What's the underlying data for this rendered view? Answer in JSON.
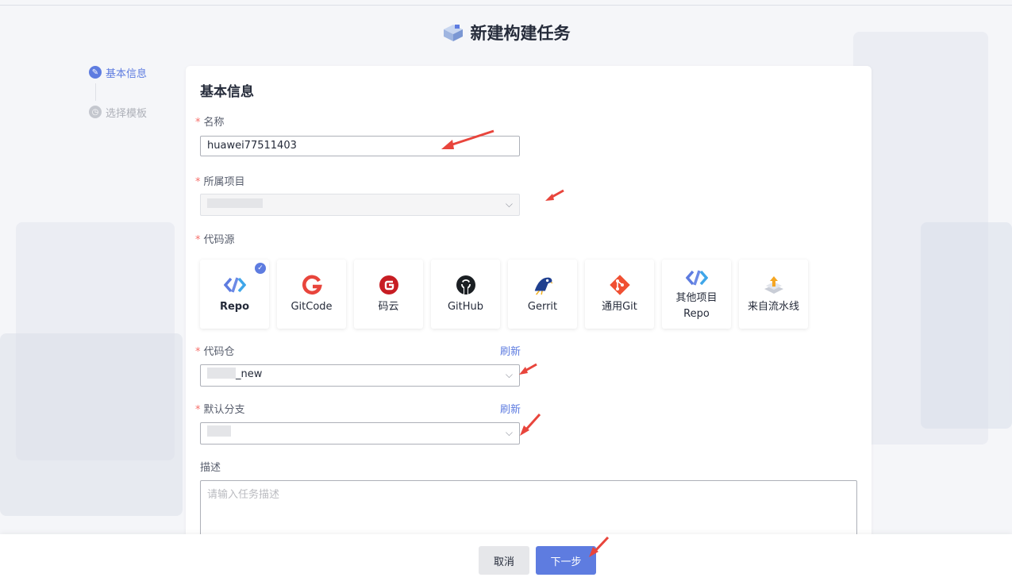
{
  "page": {
    "title": "新建构建任务"
  },
  "steps": [
    {
      "label": "基本信息",
      "state": "active",
      "icon": "edit-icon"
    },
    {
      "label": "选择模板",
      "state": "inactive",
      "icon": "clock-icon"
    }
  ],
  "form": {
    "heading": "基本信息",
    "name": {
      "label": "名称",
      "value": "huawei77511403"
    },
    "project": {
      "label": "所属项目",
      "value": ""
    },
    "source": {
      "label": "代码源",
      "options": [
        {
          "label": "Repo",
          "icon": "repo-icon",
          "selected": true
        },
        {
          "label": "GitCode",
          "icon": "gitcode-icon",
          "selected": false
        },
        {
          "label": "码云",
          "icon": "gitee-icon",
          "selected": false
        },
        {
          "label": "GitHub",
          "icon": "github-icon",
          "selected": false
        },
        {
          "label": "Gerrit",
          "icon": "gerrit-icon",
          "selected": false
        },
        {
          "label": "通用Git",
          "icon": "git-icon",
          "selected": false
        },
        {
          "label": "其他项目Repo",
          "icon": "repo-icon",
          "selected": false
        },
        {
          "label": "来自流水线",
          "icon": "pipeline-icon",
          "selected": false
        }
      ]
    },
    "repo": {
      "label": "代码仓",
      "value": "_new",
      "refresh": "刷新"
    },
    "branch": {
      "label": "默认分支",
      "value": "",
      "refresh": "刷新"
    },
    "description": {
      "label": "描述",
      "placeholder": "请输入任务描述"
    }
  },
  "footer": {
    "cancel": "取消",
    "next": "下一步"
  },
  "colors": {
    "primary": "#5e7ce0",
    "required": "#f66f6a",
    "annotation": "#e8453c"
  }
}
